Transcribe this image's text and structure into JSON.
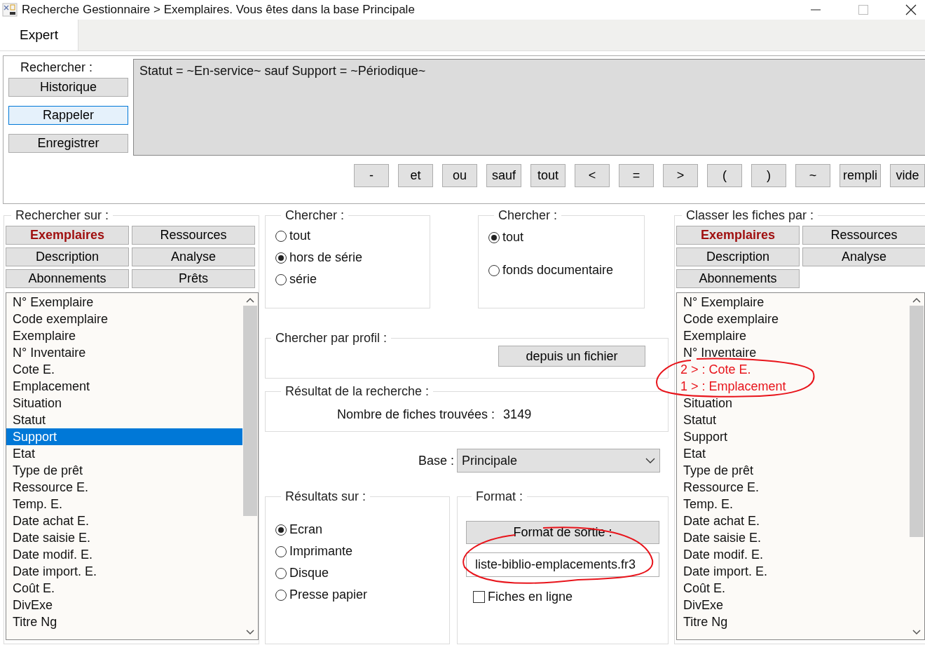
{
  "window": {
    "title": "Recherche Gestionnaire > Exemplaires.  Vous êtes dans la base Principale"
  },
  "tabs": [
    {
      "label": "Expert",
      "selected": true
    }
  ],
  "query": {
    "label": "Rechercher :",
    "buttons": [
      {
        "label": "Historique",
        "focused": false
      },
      {
        "label": "Rappeler",
        "focused": true
      },
      {
        "label": "Enregistrer",
        "focused": false
      }
    ],
    "value": "Statut = ~En-service~ sauf Support = ~Périodique~",
    "operators": [
      "-",
      "et",
      "ou",
      "sauf",
      "tout",
      "<",
      "=",
      ">",
      "(",
      ")",
      "~",
      "rempli",
      "vide"
    ]
  },
  "search_on": {
    "title": "Rechercher sur :",
    "categories": [
      {
        "label": "Exemplaires",
        "selected": true
      },
      {
        "label": "Ressources",
        "selected": false
      },
      {
        "label": "Description",
        "selected": false
      },
      {
        "label": "Analyse",
        "selected": false
      },
      {
        "label": "Abonnements",
        "selected": false
      },
      {
        "label": "Prêts",
        "selected": false
      }
    ],
    "fields": [
      {
        "label": "N° Exemplaire",
        "selected": false
      },
      {
        "label": "Code exemplaire",
        "selected": false
      },
      {
        "label": "Exemplaire",
        "selected": false
      },
      {
        "label": "N° Inventaire",
        "selected": false
      },
      {
        "label": "Cote E.",
        "selected": false
      },
      {
        "label": "Emplacement",
        "selected": false
      },
      {
        "label": "Situation",
        "selected": false
      },
      {
        "label": "Statut",
        "selected": false
      },
      {
        "label": "Support",
        "selected": true
      },
      {
        "label": "Etat",
        "selected": false
      },
      {
        "label": "Type de prêt",
        "selected": false
      },
      {
        "label": "Ressource E.",
        "selected": false
      },
      {
        "label": "Temp. E.",
        "selected": false
      },
      {
        "label": "Date achat E.",
        "selected": false
      },
      {
        "label": "Date saisie E.",
        "selected": false
      },
      {
        "label": "Date modif. E.",
        "selected": false
      },
      {
        "label": "Date import. E.",
        "selected": false
      },
      {
        "label": "Coût E.",
        "selected": false
      },
      {
        "label": "DivExe",
        "selected": false
      },
      {
        "label": "Titre Ng",
        "selected": false
      }
    ]
  },
  "search_series": {
    "title": "Chercher :",
    "options": [
      {
        "label": "tout",
        "selected": false
      },
      {
        "label": "hors de série",
        "selected": true
      },
      {
        "label": "série",
        "selected": false
      }
    ]
  },
  "search_scope": {
    "title": "Chercher :",
    "options": [
      {
        "label": "tout",
        "selected": true
      },
      {
        "label": "fonds documentaire",
        "selected": false
      }
    ]
  },
  "profile": {
    "title": "Chercher par profil :",
    "button": "depuis un fichier"
  },
  "result": {
    "title": "Résultat de la recherche :",
    "label": "Nombre de fiches trouvées :",
    "count": "3149"
  },
  "base": {
    "label": "Base :",
    "value": "Principale"
  },
  "output": {
    "title": "Résultats sur :",
    "options": [
      {
        "label": "Ecran",
        "selected": true
      },
      {
        "label": "Imprimante",
        "selected": false
      },
      {
        "label": "Disque",
        "selected": false
      },
      {
        "label": "Presse papier",
        "selected": false
      }
    ]
  },
  "format": {
    "title": "Format :",
    "button": "Format de sortie :",
    "file": "liste-biblio-emplacements.fr3",
    "online": {
      "label": "Fiches en ligne",
      "checked": false
    }
  },
  "sort_by": {
    "title": "Classer les fiches par :",
    "categories": [
      {
        "label": "Exemplaires",
        "selected": true
      },
      {
        "label": "Ressources",
        "selected": false
      },
      {
        "label": "Description",
        "selected": false
      },
      {
        "label": "Analyse",
        "selected": false
      },
      {
        "label": "Abonnements",
        "selected": false
      }
    ],
    "fields": [
      {
        "label": "N° Exemplaire",
        "sorted": false
      },
      {
        "label": "Code exemplaire",
        "sorted": false
      },
      {
        "label": "Exemplaire",
        "sorted": false
      },
      {
        "label": "N° Inventaire",
        "sorted": false
      },
      {
        "label": "2 > :  Cote E.",
        "sorted": true
      },
      {
        "label": "1 > :  Emplacement",
        "sorted": true
      },
      {
        "label": "Situation",
        "sorted": false
      },
      {
        "label": "Statut",
        "sorted": false
      },
      {
        "label": "Support",
        "sorted": false
      },
      {
        "label": "Etat",
        "sorted": false
      },
      {
        "label": "Type de prêt",
        "sorted": false
      },
      {
        "label": "Ressource E.",
        "sorted": false
      },
      {
        "label": "Temp. E.",
        "sorted": false
      },
      {
        "label": "Date achat E.",
        "sorted": false
      },
      {
        "label": "Date saisie E.",
        "sorted": false
      },
      {
        "label": "Date modif. E.",
        "sorted": false
      },
      {
        "label": "Date import. E.",
        "sorted": false
      },
      {
        "label": "Coût E.",
        "sorted": false
      },
      {
        "label": "DivExe",
        "sorted": false
      },
      {
        "label": "Titre Ng",
        "sorted": false
      }
    ]
  }
}
